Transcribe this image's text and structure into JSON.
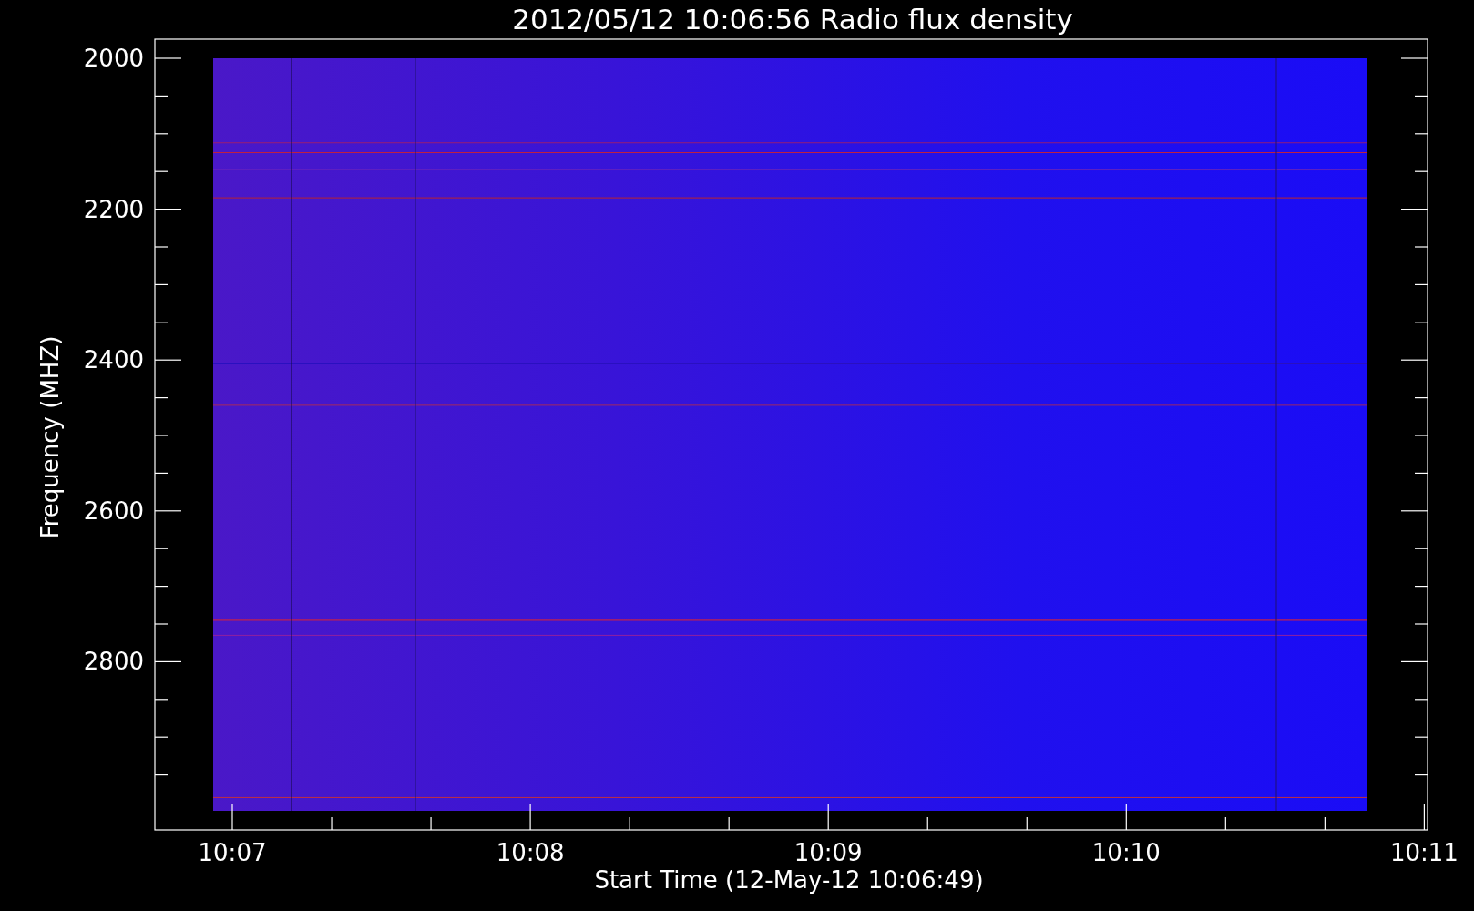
{
  "title": "2012/05/12 10:06:56 Radio flux density",
  "plot": {
    "ylabel": "Frequency (MHZ)",
    "xlabel": "Start Time (12-May-12 10:06:49)",
    "yticks": [
      "2000",
      "2200",
      "2400",
      "2600",
      "2800"
    ],
    "xticks": [
      "10:07",
      "10:08",
      "10:09",
      "10:10",
      "10:11"
    ]
  }
}
